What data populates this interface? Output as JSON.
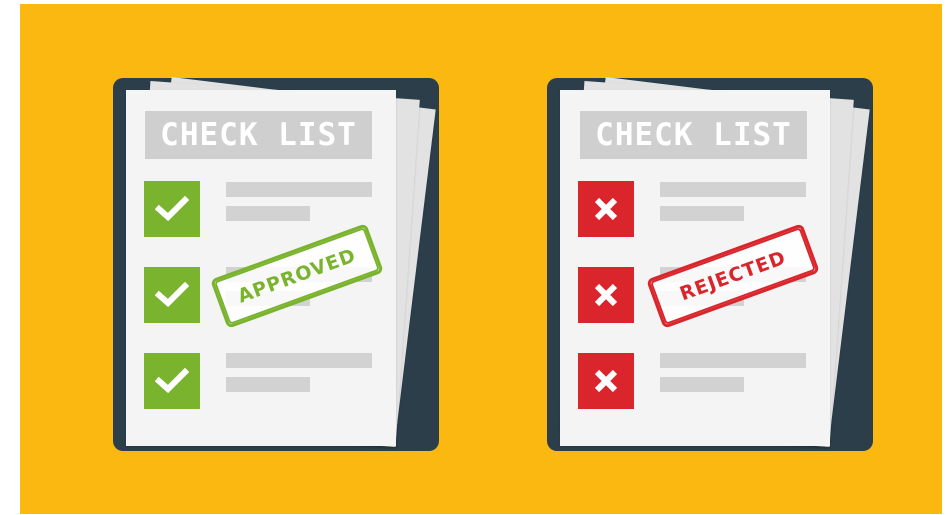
{
  "colors": {
    "background": "#fbb811",
    "clipboard": "#2c3e4a",
    "approved": "#7ab32e",
    "rejected": "#d9252b"
  },
  "left_checklist": {
    "title": "CHECK LIST",
    "stamp": "APPROVED",
    "mark_icon": "checkmark-icon"
  },
  "right_checklist": {
    "title": "CHECK LIST",
    "stamp": "REJECTED",
    "mark_icon": "cross-icon"
  }
}
